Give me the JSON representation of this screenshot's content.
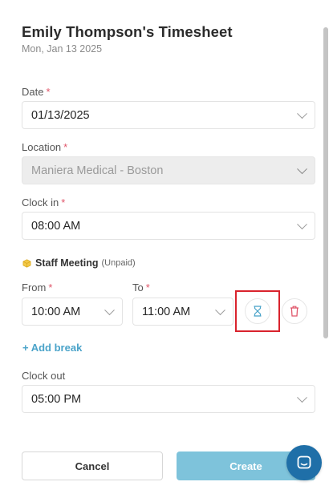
{
  "header": {
    "title": "Emily Thompson's Timesheet",
    "date": "Mon, Jan 13 2025"
  },
  "form": {
    "date": {
      "label": "Date",
      "required_mark": "*",
      "value": "01/13/2025"
    },
    "location": {
      "label": "Location",
      "required_mark": "*",
      "value": "Maniera Medical - Boston"
    },
    "clock_in": {
      "label": "Clock in",
      "required_mark": "*",
      "value": "08:00 AM"
    },
    "break": {
      "title": "Staff Meeting",
      "type": "(Unpaid)",
      "from": {
        "label": "From",
        "required_mark": "*",
        "value": "10:00 AM"
      },
      "to": {
        "label": "To",
        "required_mark": "*",
        "value": "11:00 AM"
      },
      "timer_icon": "hourglass-icon",
      "delete_icon": "trash-icon"
    },
    "add_break": "+ Add break",
    "clock_out": {
      "label": "Clock out",
      "value": "05:00 PM"
    }
  },
  "actions": {
    "cancel": "Cancel",
    "create": "Create"
  },
  "colors": {
    "required": "#e0566a",
    "accent": "#4aa3c9",
    "create_button": "#7ec3db",
    "highlight": "#d9232d",
    "chat": "#1f6fa8"
  },
  "icons": {
    "break": "cube-icon",
    "chat": "chat-icon"
  }
}
